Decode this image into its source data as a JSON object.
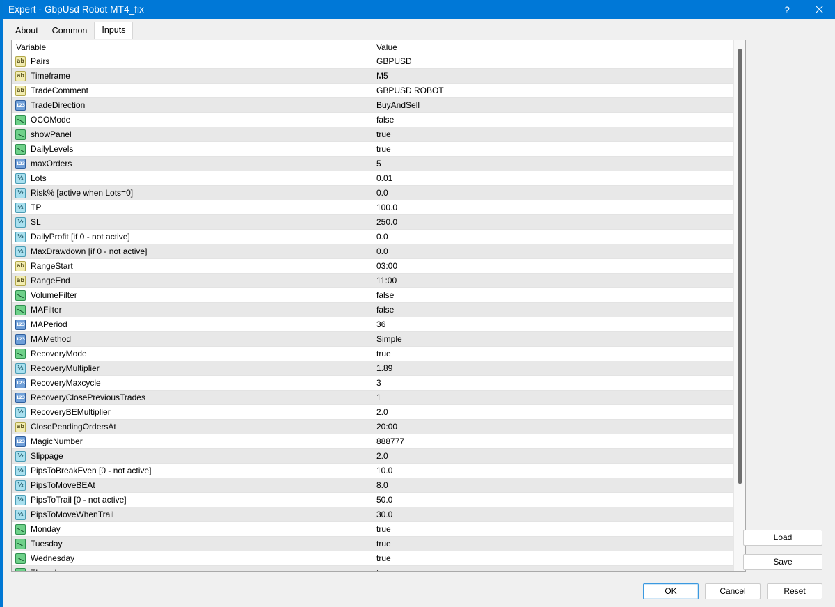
{
  "window": {
    "title": "Expert - GbpUsd Robot MT4_fix",
    "help_icon": "?",
    "close_icon": "close-icon",
    "accent_color": "#0078d7"
  },
  "tabs": [
    {
      "label": "About",
      "active": false
    },
    {
      "label": "Common",
      "active": false
    },
    {
      "label": "Inputs",
      "active": true
    }
  ],
  "grid": {
    "columns": {
      "variable": "Variable",
      "value": "Value"
    },
    "rows": [
      {
        "type": "string",
        "name": "Pairs",
        "value": "GBPUSD"
      },
      {
        "type": "string",
        "name": "Timeframe",
        "value": "M5"
      },
      {
        "type": "string",
        "name": "TradeComment",
        "value": "GBPUSD ROBOT"
      },
      {
        "type": "int",
        "name": "TradeDirection",
        "value": "BuyAndSell"
      },
      {
        "type": "bool",
        "name": "OCOMode",
        "value": "false"
      },
      {
        "type": "bool",
        "name": "showPanel",
        "value": "true"
      },
      {
        "type": "bool",
        "name": "DailyLevels",
        "value": "true"
      },
      {
        "type": "int",
        "name": "maxOrders",
        "value": "5"
      },
      {
        "type": "float",
        "name": "Lots",
        "value": "0.01"
      },
      {
        "type": "float",
        "name": "Risk% [active when Lots=0]",
        "value": "0.0"
      },
      {
        "type": "float",
        "name": "TP",
        "value": "100.0"
      },
      {
        "type": "float",
        "name": "SL",
        "value": "250.0"
      },
      {
        "type": "float",
        "name": "DailyProfit [if 0 - not active]",
        "value": "0.0"
      },
      {
        "type": "float",
        "name": "MaxDrawdown [if 0 - not active]",
        "value": "0.0"
      },
      {
        "type": "string",
        "name": "RangeStart",
        "value": "03:00"
      },
      {
        "type": "string",
        "name": "RangeEnd",
        "value": "11:00"
      },
      {
        "type": "bool",
        "name": "VolumeFilter",
        "value": "false"
      },
      {
        "type": "bool",
        "name": "MAFilter",
        "value": "false"
      },
      {
        "type": "int",
        "name": "MAPeriod",
        "value": "36"
      },
      {
        "type": "int",
        "name": "MAMethod",
        "value": "Simple"
      },
      {
        "type": "bool",
        "name": "RecoveryMode",
        "value": "true"
      },
      {
        "type": "float",
        "name": "RecoveryMultiplier",
        "value": "1.89"
      },
      {
        "type": "int",
        "name": "RecoveryMaxcycle",
        "value": "3"
      },
      {
        "type": "int",
        "name": "RecoveryClosePreviousTrades",
        "value": "1"
      },
      {
        "type": "float",
        "name": "RecoveryBEMultiplier",
        "value": "2.0"
      },
      {
        "type": "string",
        "name": "ClosePendingOrdersAt",
        "value": "20:00"
      },
      {
        "type": "int",
        "name": "MagicNumber",
        "value": "888777"
      },
      {
        "type": "float",
        "name": "Slippage",
        "value": "2.0"
      },
      {
        "type": "float",
        "name": "PipsToBreakEven [0 - not active]",
        "value": "10.0"
      },
      {
        "type": "float",
        "name": "PipsToMoveBEAt",
        "value": "8.0"
      },
      {
        "type": "float",
        "name": "PipsToTrail [0 - not active]",
        "value": "50.0"
      },
      {
        "type": "float",
        "name": "PipsToMoveWhenTrail",
        "value": "30.0"
      },
      {
        "type": "bool",
        "name": "Monday",
        "value": "true"
      },
      {
        "type": "bool",
        "name": "Tuesday",
        "value": "true"
      },
      {
        "type": "bool",
        "name": "Wednesday",
        "value": "true"
      },
      {
        "type": "bool",
        "name": "Thursday",
        "value": "true"
      }
    ]
  },
  "side_buttons": {
    "load": "Load",
    "save": "Save"
  },
  "dialog_buttons": {
    "ok": "OK",
    "cancel": "Cancel",
    "reset": "Reset"
  },
  "icon_labels": {
    "string": "ab",
    "int": "123",
    "float": "½"
  }
}
